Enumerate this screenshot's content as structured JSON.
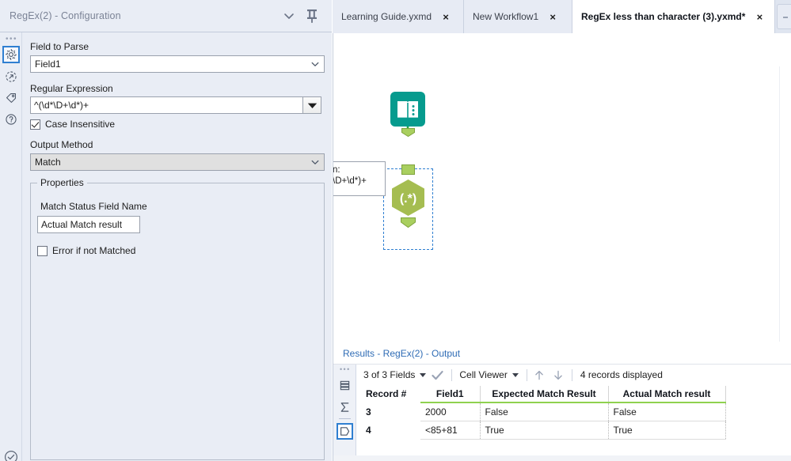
{
  "config": {
    "title": "RegEx(2) - Configuration",
    "header_icons": {
      "collapse": "chevron-down-icon",
      "pin": "pin-icon"
    },
    "rail": [
      {
        "name": "gear-icon",
        "label": "Configuration",
        "selected": true
      },
      {
        "name": "run-icon",
        "label": "Annotation"
      },
      {
        "name": "tag-icon",
        "label": "Labels"
      },
      {
        "name": "help-icon",
        "label": "Help"
      }
    ],
    "rail_bottom_icon": "check-circle-icon",
    "field_to_parse": {
      "label": "Field to Parse",
      "value": "Field1"
    },
    "regular_expression": {
      "label": "Regular Expression",
      "value": "^(\\d*\\D+\\d*)+"
    },
    "case_insensitive": {
      "label": "Case Insensitive",
      "checked": true
    },
    "output_method": {
      "label": "Output Method",
      "value": "Match"
    },
    "properties": {
      "title": "Properties",
      "match_status_field_name": {
        "label": "Match Status Field Name",
        "value": "Actual Match result"
      },
      "error_if_not_matched": {
        "label": "Error if not Matched",
        "checked": false
      }
    }
  },
  "tabs": [
    {
      "label": "Learning Guide.yxmd",
      "active": false,
      "close": "×"
    },
    {
      "label": "New Workflow1",
      "active": false,
      "close": "×"
    },
    {
      "label": "RegEx less than character (3).yxmd*",
      "active": true,
      "close": "×"
    }
  ],
  "canvas": {
    "nodes": [
      {
        "name": "text-input-node",
        "icon": "book-icon",
        "color": "#069b8e",
        "selected": false
      },
      {
        "name": "regex-node",
        "icon": "regex-icon",
        "glyph": "(.*)",
        "color": "#a5bd51",
        "selected": true
      }
    ],
    "tooltip_text_line1": "n:",
    "tooltip_text_line2": "\\D+\\d*)+"
  },
  "results": {
    "title": "Results - RegEx(2) - Output",
    "rail": [
      {
        "name": "data-icon",
        "selected": false
      },
      {
        "name": "profile-sigma-icon",
        "selected": false
      },
      {
        "name": "metadata-icon",
        "selected": true
      }
    ],
    "toolbar": {
      "fields_label": "3 of 3 Fields",
      "check_icon": "check-icon",
      "viewer_label": "Cell Viewer",
      "up_icon": "arrow-up-icon",
      "down_icon": "arrow-down-icon",
      "record_count": "4 records displayed"
    },
    "table": {
      "columns": [
        "Record #",
        "Field1",
        "Expected Match Result",
        "Actual Match result"
      ],
      "rows": [
        [
          "3",
          "2000",
          "False",
          "False"
        ],
        [
          "4",
          "<85+81",
          "True",
          "True"
        ]
      ]
    }
  },
  "colors": {
    "panel_bg": "#e9edf5",
    "accent_blue": "#2f7fd1",
    "link_blue": "#2f6cb5",
    "green_header": "#8fd14f",
    "teal_node": "#069b8e",
    "olive_node": "#a5bd51",
    "connector_green": "#28a745"
  }
}
